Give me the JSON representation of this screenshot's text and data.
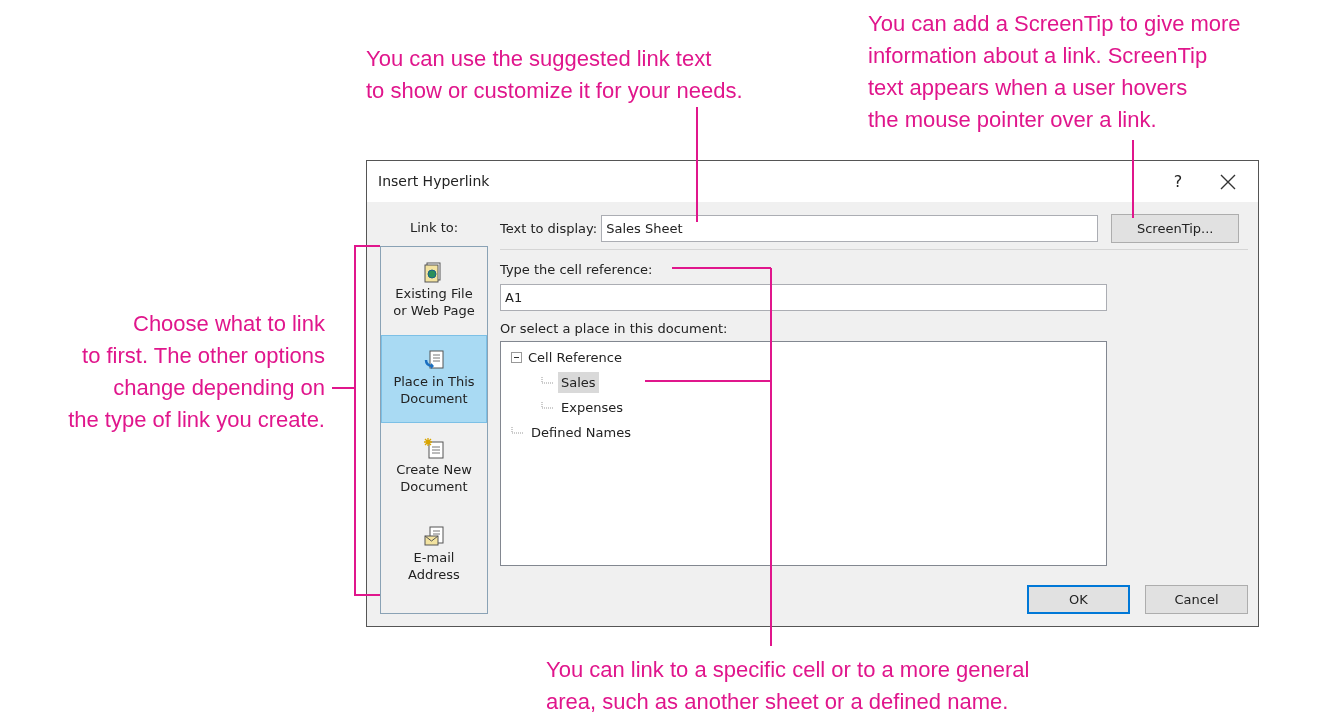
{
  "annotations": [
    {
      "kind": "top",
      "lines": [
        "You can use the suggested link text",
        "to show or customize it for your needs."
      ]
    },
    {
      "kind": "right",
      "lines": [
        "You can add a ScreenTip to give more",
        "information about a link. ScreenTip",
        "text appears when a user hovers",
        "the mouse pointer over a link."
      ]
    },
    {
      "kind": "left",
      "lines": [
        "Choose what to link",
        "to first. The other options",
        "change depending on",
        "the type of link you create."
      ]
    },
    {
      "kind": "bottom",
      "lines": [
        "You can link to a specific cell or to a more general",
        "area, such as another sheet or a defined name."
      ]
    }
  ],
  "dialog": {
    "title": "Insert Hyperlink",
    "help_button": "?",
    "link_to_label": "Link to:",
    "link_to_items": [
      {
        "kind": "file",
        "lines": [
          "Existing File",
          "or Web Page"
        ],
        "selected": false
      },
      {
        "kind": "place",
        "lines": [
          "Place in This",
          "Document"
        ],
        "selected": true
      },
      {
        "kind": "new",
        "lines": [
          "Create New",
          "Document"
        ],
        "selected": false
      },
      {
        "kind": "email",
        "lines": [
          "E-mail",
          "Address"
        ],
        "selected": false
      }
    ],
    "text_to_display": {
      "label": "Text to display:",
      "value": "Sales Sheet"
    },
    "screentip_button": "ScreenTip...",
    "cell_reference": {
      "label": "Type the cell reference:",
      "value": "A1"
    },
    "place_label": "Or select a place in this document:",
    "tree": [
      {
        "label": "Cell Reference",
        "expanded": true,
        "selected": false,
        "children": [
          {
            "label": "Sales",
            "selected": true
          },
          {
            "label": "Expenses",
            "selected": false
          }
        ]
      },
      {
        "label": "Defined Names",
        "selected": false
      }
    ],
    "buttons": [
      {
        "label": "OK",
        "default": true
      },
      {
        "label": "Cancel",
        "default": false
      }
    ]
  }
}
